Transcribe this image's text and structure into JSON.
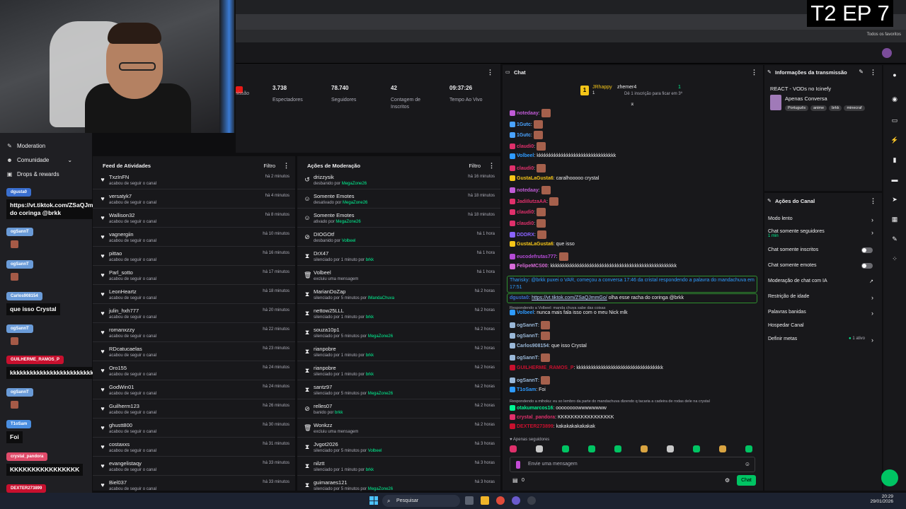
{
  "overlay_title": "T2 EP 7",
  "browser": {
    "bookmarks_label": "Todos os favoritos"
  },
  "sidebar": {
    "items": [
      {
        "label": "Moderation",
        "icon": "sword-icon"
      },
      {
        "label": "Comunidade",
        "icon": "community-icon"
      },
      {
        "label": "Drops & rewards",
        "icon": "gift-icon"
      }
    ]
  },
  "overlay_chat": [
    {
      "name": "dgusta0",
      "color": "#3a6fcf",
      "message": "https://vt.tiktok.com/ZSaQJmmGo/ olha esse racha do coringa @brkk"
    },
    {
      "name": "ogSannT",
      "color": "#6a9bd8",
      "message": ""
    },
    {
      "name": "ogSannT",
      "color": "#6a9bd8",
      "message": ""
    },
    {
      "name": "Carlos908154",
      "color": "#6a9bd8",
      "message": "que isso Crystal"
    },
    {
      "name": "ogSannT",
      "color": "#6a9bd8",
      "message": ""
    },
    {
      "name": "GUILHERME_RAMOS_P",
      "color": "#c8102e",
      "message": "kkkkkkkkkkkkkkkkkkkkkkkkkkkkkkkk"
    },
    {
      "name": "ogSannT",
      "color": "#6a9bd8",
      "message": ""
    },
    {
      "name": "T1oSam",
      "color": "#4a8ee0",
      "message": "Foi"
    },
    {
      "name": "crystal_pandora",
      "color": "#e04b6a",
      "message": "KKKKKKKKKKKKKKKK"
    },
    {
      "name": "DEXTER273899",
      "color": "#c8102e",
      "message": "kakakakakakakak"
    }
  ],
  "stats": [
    {
      "value": "",
      "label": "missão"
    },
    {
      "value": "3.738",
      "label": "Espectadores"
    },
    {
      "value": "78.740",
      "label": "Seguidores"
    },
    {
      "value": "42",
      "label": "Contagem de Inscritos"
    },
    {
      "value": "09:37:26",
      "label": "Tempo Ao Vivo"
    }
  ],
  "activity_feed": {
    "title": "Feed de Atividades",
    "filter": "Filtro",
    "rows": [
      {
        "name": "TxzInFN",
        "sub": "acabou de seguir o canal",
        "time": "há 2 minutos"
      },
      {
        "name": "versatyk7",
        "sub": "acabou de seguir o canal",
        "time": "há 4 minutos"
      },
      {
        "name": "Wallison32",
        "sub": "acabou de seguir o canal",
        "time": "há 8 minutos"
      },
      {
        "name": "vagnergiin",
        "sub": "acabou de seguir o canal",
        "time": "há 10 minutos"
      },
      {
        "name": "pittao",
        "sub": "acabou de seguir o canal",
        "time": "há 16 minutos"
      },
      {
        "name": "Parl_sotto",
        "sub": "acabou de seguir o canal",
        "time": "há 17 minutos"
      },
      {
        "name": "LeonHeartz",
        "sub": "acabou de seguir o canal",
        "time": "há 18 minutos"
      },
      {
        "name": "julin_hxh777",
        "sub": "acabou de seguir o canal",
        "time": "há 20 minutos"
      },
      {
        "name": "romanxzzy",
        "sub": "acabou de seguir o canal",
        "time": "há 22 minutos"
      },
      {
        "name": "RDcatucaelas",
        "sub": "acabou de seguir o canal",
        "time": "há 23 minutos"
      },
      {
        "name": "Oro155",
        "sub": "acabou de seguir o canal",
        "time": "há 24 minutos"
      },
      {
        "name": "GodWin01",
        "sub": "acabou de seguir o canal",
        "time": "há 24 minutos"
      },
      {
        "name": "Guilherm123",
        "sub": "acabou de seguir o canal",
        "time": "há 26 minutos"
      },
      {
        "name": "ghustt800",
        "sub": "acabou de seguir o canal",
        "time": "há 30 minutos"
      },
      {
        "name": "costaxxs",
        "sub": "acabou de seguir o canal",
        "time": "há 31 minutos"
      },
      {
        "name": "evangelistaqy",
        "sub": "acabou de seguir o canal",
        "time": "há 33 minutos"
      },
      {
        "name": "Biel037",
        "sub": "acabou de seguir o canal",
        "time": "há 33 minutos"
      }
    ]
  },
  "mod_actions": {
    "title": "Ações de Moderação",
    "filter": "Filtro",
    "rows": [
      {
        "icon": "unban-icon",
        "name": "drizzysik",
        "sub": "desbanido por ",
        "by": "MegaZone26",
        "time": "há 16 minutos"
      },
      {
        "icon": "emote-icon",
        "name": "Somente Emotes",
        "sub": "desativado por ",
        "by": "MegaZone26",
        "time": "há 18 minutos"
      },
      {
        "icon": "emote-icon",
        "name": "Somente Emotes",
        "sub": "ativado por ",
        "by": "MegaZone26",
        "time": "há 18 minutos"
      },
      {
        "icon": "ban-icon",
        "name": "DIOGOtf",
        "sub": "desbanido por ",
        "by": "Volbeel",
        "time": "há 1 hora"
      },
      {
        "icon": "timeout-icon",
        "name": "DrX47",
        "sub": "silenciado por 1 minuto por ",
        "by": "brkk",
        "time": "há 1 hora"
      },
      {
        "icon": "trash-icon",
        "name": "Volbeel",
        "sub": "excluiu uma mensagem",
        "by": "",
        "time": "há 1 hora"
      },
      {
        "icon": "timeout-icon",
        "name": "MarianDoZap",
        "sub": "silenciado por 5 minutos por ",
        "by": "IMandaChuva",
        "time": "há 2 horas"
      },
      {
        "icon": "timeout-icon",
        "name": "nettow25LLL",
        "sub": "silenciado por 1 minuto por ",
        "by": "brkk",
        "time": "há 2 horas"
      },
      {
        "icon": "timeout-icon",
        "name": "souza10p1",
        "sub": "silenciado por 5 minutos por ",
        "by": "MegaZone26",
        "time": "há 2 horas"
      },
      {
        "icon": "timeout-icon",
        "name": "rianpobre",
        "sub": "silenciado por 1 minuto por ",
        "by": "brkk",
        "time": "há 2 horas"
      },
      {
        "icon": "timeout-icon",
        "name": "rianpobre",
        "sub": "silenciado por 1 minuto por ",
        "by": "brkk",
        "time": "há 2 horas"
      },
      {
        "icon": "timeout-icon",
        "name": "santz97",
        "sub": "silenciado por 5 minutos por ",
        "by": "MegaZone26",
        "time": "há 2 horas"
      },
      {
        "icon": "ban-icon",
        "name": "relles07",
        "sub": "banido por ",
        "by": "brkk",
        "time": "há 2 horas"
      },
      {
        "icon": "trash-icon",
        "name": "Wonkzz",
        "sub": "excluiu uma mensagem",
        "by": "",
        "time": "há 2 horas"
      },
      {
        "icon": "timeout-icon",
        "name": "Jvgot2026",
        "sub": "silenciado por 5 minutos por ",
        "by": "Volbeel",
        "time": "há 3 horas"
      },
      {
        "icon": "timeout-icon",
        "name": "nilztt",
        "sub": "silenciado por 1 minuto por ",
        "by": "brkk",
        "time": "há 3 horas"
      },
      {
        "icon": "timeout-icon",
        "name": "guimaraes121",
        "sub": "silenciado por 5 minutos por ",
        "by": "MegaZone26",
        "time": "há 3 horas"
      }
    ]
  },
  "chat": {
    "title": "Chat",
    "top_gifter_1": "JRhappy",
    "top_gifter_1_count": "1",
    "top_gifter_2": "zhemer4",
    "top_gifter_2_count": "1",
    "top_note": "Dê 1 inscrição para ficar em 3º",
    "messages": [
      {
        "user": "notedaay",
        "color": "#c05bd6",
        "text": ""
      },
      {
        "user": "1Gutc",
        "color": "#4aa3ff",
        "text": ""
      },
      {
        "user": "1Gutc",
        "color": "#4aa3ff",
        "text": ""
      },
      {
        "user": "claudi0",
        "color": "#e0306b",
        "text": ""
      },
      {
        "user": "Volbeel",
        "color": "#2e9bff",
        "text": "kkkkkkkkkkkkkkkkkkkkkkkkkkkkkkkk"
      },
      {
        "user": "claudi0",
        "color": "#e0306b",
        "text": ""
      },
      {
        "user": "GustaLaGusta6",
        "color": "#f5c518",
        "text": "caralhooooo crystal"
      },
      {
        "user": "notedaay",
        "color": "#c05bd6",
        "text": ""
      },
      {
        "user": "JadiIlutzaAA",
        "color": "#e0306b",
        "text": ""
      },
      {
        "user": "claudi0",
        "color": "#e0306b",
        "text": ""
      },
      {
        "user": "claudi0",
        "color": "#e0306b",
        "text": ""
      },
      {
        "user": "DDDRX",
        "color": "#8a63ff",
        "text": ""
      },
      {
        "user": "GustaLaGusta6",
        "color": "#f5c518",
        "text": "que isso"
      },
      {
        "user": "eucodefrutas777",
        "color": "#b44bd6",
        "text": ""
      },
      {
        "user": "FelipeMCS00",
        "color": "#d86bd8",
        "text": "kkkkkkkkkkkkkkkkkkkkkkkkkkkkkkkkkkkkkkkkkkkkkkkkkkk"
      }
    ],
    "highlight_1": "Tharisky: @brkk puxei o VAR, começou a conversa 17:46 da cristal respondendo a palavra do mandachuva em 17:51",
    "highlight_2_user": "dgusta0:",
    "highlight_2_link": "https://vt.tiktok.com/ZSaQJmmGo/",
    "highlight_2_text": " olha esse racha do coringa @brkk",
    "reply_note_1": "Respondendo a Volbeel: manda chuva sabe das coisas",
    "messages_2": [
      {
        "user": "Volbeel",
        "color": "#2e9bff",
        "text": "nunca mais fala isso com o meu Nick mlk"
      },
      {
        "user": "ogSannT",
        "color": "#9ab8d8",
        "text": ""
      },
      {
        "user": "ogSannT",
        "color": "#9ab8d8",
        "text": ""
      },
      {
        "user": "Carlos908154",
        "color": "#9ab8d8",
        "text": "que isso Crystal"
      },
      {
        "user": "ogSannT",
        "color": "#9ab8d8",
        "text": ""
      },
      {
        "user": "GUILHERME_RAMOS_P",
        "color": "#c8102e",
        "text": "kkkkkkkkkkkkkkkkkkkkkkkkkkkkkkkkkkk"
      },
      {
        "user": "ogSannT",
        "color": "#9ab8d8",
        "text": ""
      },
      {
        "user": "T1oSam",
        "color": "#2e9bff",
        "text": "Foi"
      }
    ],
    "reply_note_2": "Respondendo a mihoku: eu so lembro da parte do mandachuva dizendo q tacaria a cadeira de rodas dele na crystal",
    "messages_3": [
      {
        "user": "otakumarcos16",
        "color": "#00f593",
        "text": "oooooooowwwwwwww"
      },
      {
        "user": "crystal_pandora",
        "color": "#e0306b",
        "text": "KKKKKKKKKKKKKKKKK"
      },
      {
        "user": "DEXTER273899",
        "color": "#c8102e",
        "text": "kakakakakakakak"
      }
    ],
    "followers_only_note": "Apenas seguidores",
    "input_placeholder": "Envie uma mensagem",
    "points": "0",
    "send_label": "Chat"
  },
  "stream_info": {
    "title": "Informações da transmissão",
    "stream_title": "REACT - VODs no Icinefy",
    "category": "Apenas Conversa",
    "tags": [
      "Português",
      "anime",
      "brkk",
      "minecraf"
    ]
  },
  "channel_actions": {
    "title": "Ações do Canal",
    "items": [
      {
        "label": "Modo lento",
        "sub": "",
        "control": "chevron"
      },
      {
        "label": "Chat somente seguidores",
        "sub": "1 min",
        "control": "chevron"
      },
      {
        "label": "Chat somente inscritos",
        "sub": "",
        "control": "toggle"
      },
      {
        "label": "Chat somente emotes",
        "sub": "",
        "control": "toggle"
      },
      {
        "label": "Moderação de chat com IA",
        "sub": "",
        "control": "external"
      },
      {
        "label": "Restrição de idade",
        "sub": "",
        "control": "chevron"
      },
      {
        "label": "Palavras banidas",
        "sub": "",
        "control": "chevron"
      },
      {
        "label": "Hospedar Canal",
        "sub": "",
        "control": "none"
      },
      {
        "label": "Definir metas",
        "sub": "",
        "control": "chevron"
      }
    ],
    "metas_status": "1 ativo"
  },
  "taskbar": {
    "search_placeholder": "Pesquisar",
    "time": "20:29",
    "date": "29/01/2026"
  }
}
